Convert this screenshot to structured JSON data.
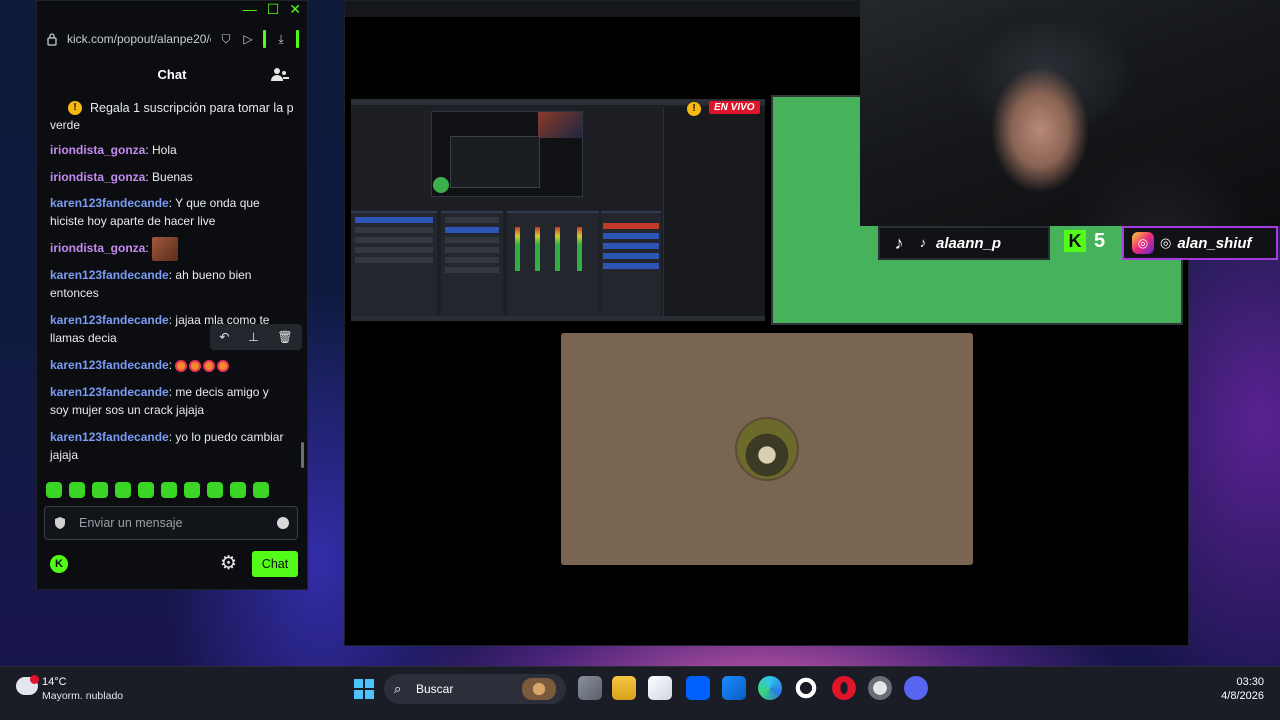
{
  "chat_window": {
    "url": "kick.com/popout/alanpe20/c",
    "title": "Chat",
    "pinned_text": "Regala 1 suscripción para tomar la p",
    "partial_top_text": "verde",
    "messages": [
      {
        "user": "iriondista_gonza",
        "text": ": Hola",
        "color": "purple"
      },
      {
        "user": "iriondista_gonza",
        "text": ": Buenas",
        "color": "purple"
      },
      {
        "user": "karen123fandecande",
        "text": ": Y que onda que hiciste hoy aparte de hacer live",
        "color": "blue"
      },
      {
        "user": "iriondista_gonza",
        "text": ":",
        "color": "purple"
      },
      {
        "user": "karen123fandecande",
        "text": ": ah bueno bien entonces",
        "color": "blue"
      },
      {
        "user": "karen123fandecande",
        "text": ": jajaa mla como te llamas decia",
        "color": "blue"
      },
      {
        "user": "karen123fandecande",
        "text": ":",
        "color": "blue"
      },
      {
        "user": "karen123fandecande",
        "text": ": me decis amigo y soy mujer sos un crack jajaja",
        "color": "blue"
      },
      {
        "user": "karen123fandecande",
        "text": ": yo lo puedo cambiar jajaja",
        "color": "blue"
      }
    ],
    "input_placeholder": "Enviar un mensaje",
    "send_label": "Chat",
    "kick_logo_letter": "K"
  },
  "obs": {
    "live_label": "EN VIVO",
    "warn_mark": "!"
  },
  "overlay": {
    "tiktok_handle": "alaann_p",
    "kick_letter": "K",
    "kick_count": "5",
    "instagram_handle": "alan_shiuf"
  },
  "taskbar": {
    "weather_temp": "14°C",
    "weather_desc": "Mayorm. nublado",
    "search_placeholder": "Buscar",
    "time": "03:30",
    "date": "4/8/2026"
  },
  "colors": {
    "kick_green": "#53fc18",
    "overlay_green": "#47b25c",
    "live_red": "#e0142a"
  }
}
